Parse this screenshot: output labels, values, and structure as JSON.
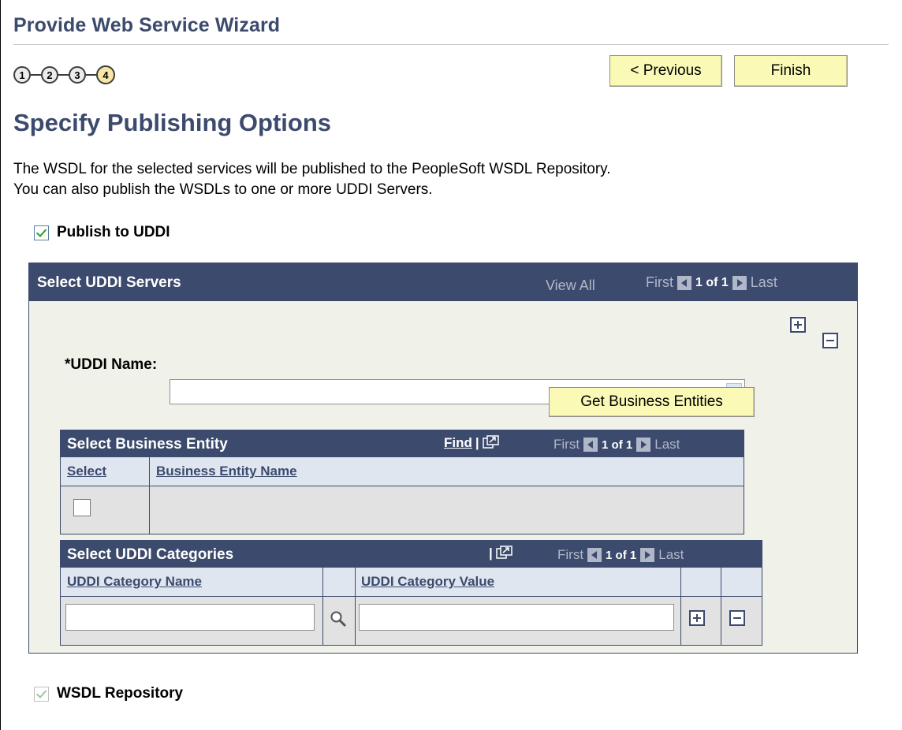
{
  "wizard": {
    "title": "Provide Web Service Wizard",
    "steps": [
      "1",
      "2",
      "3",
      "4"
    ],
    "current_step": 4
  },
  "buttons": {
    "previous": "< Previous",
    "finish": "Finish",
    "get_business_entities": "Get Business Entities"
  },
  "page": {
    "title": "Specify Publishing Options",
    "description_line1": "The WSDL for the selected services will be published to the PeopleSoft WSDL Repository.",
    "description_line2": "You can also publish the WSDLs to one or more UDDI Servers."
  },
  "publish_to_uddi": {
    "label": "Publish to UDDI",
    "checked": true
  },
  "uddi_servers": {
    "title": "Select UDDI Servers",
    "view_all": "View All",
    "first": "First",
    "count": "1 of 1",
    "last": "Last",
    "uddi_name_label": "*UDDI Name:",
    "uddi_name_value": ""
  },
  "business_entity": {
    "title": "Select Business Entity",
    "find": "Find",
    "separator": "|",
    "first": "First",
    "count": "1 of 1",
    "last": "Last",
    "columns": [
      "Select",
      "Business Entity Name"
    ]
  },
  "uddi_categories": {
    "title": "Select UDDI Categories",
    "separator": "|",
    "first": "First",
    "count": "1 of 1",
    "last": "Last",
    "columns": [
      "UDDI Category Name",
      "UDDI Category Value"
    ]
  },
  "wsdl_repository": {
    "label": "WSDL Repository",
    "checked": true,
    "disabled": true
  },
  "colors": {
    "header_bg": "#3c4a6d",
    "button_bg": "#fafab6",
    "title_text": "#3c4a6d"
  }
}
